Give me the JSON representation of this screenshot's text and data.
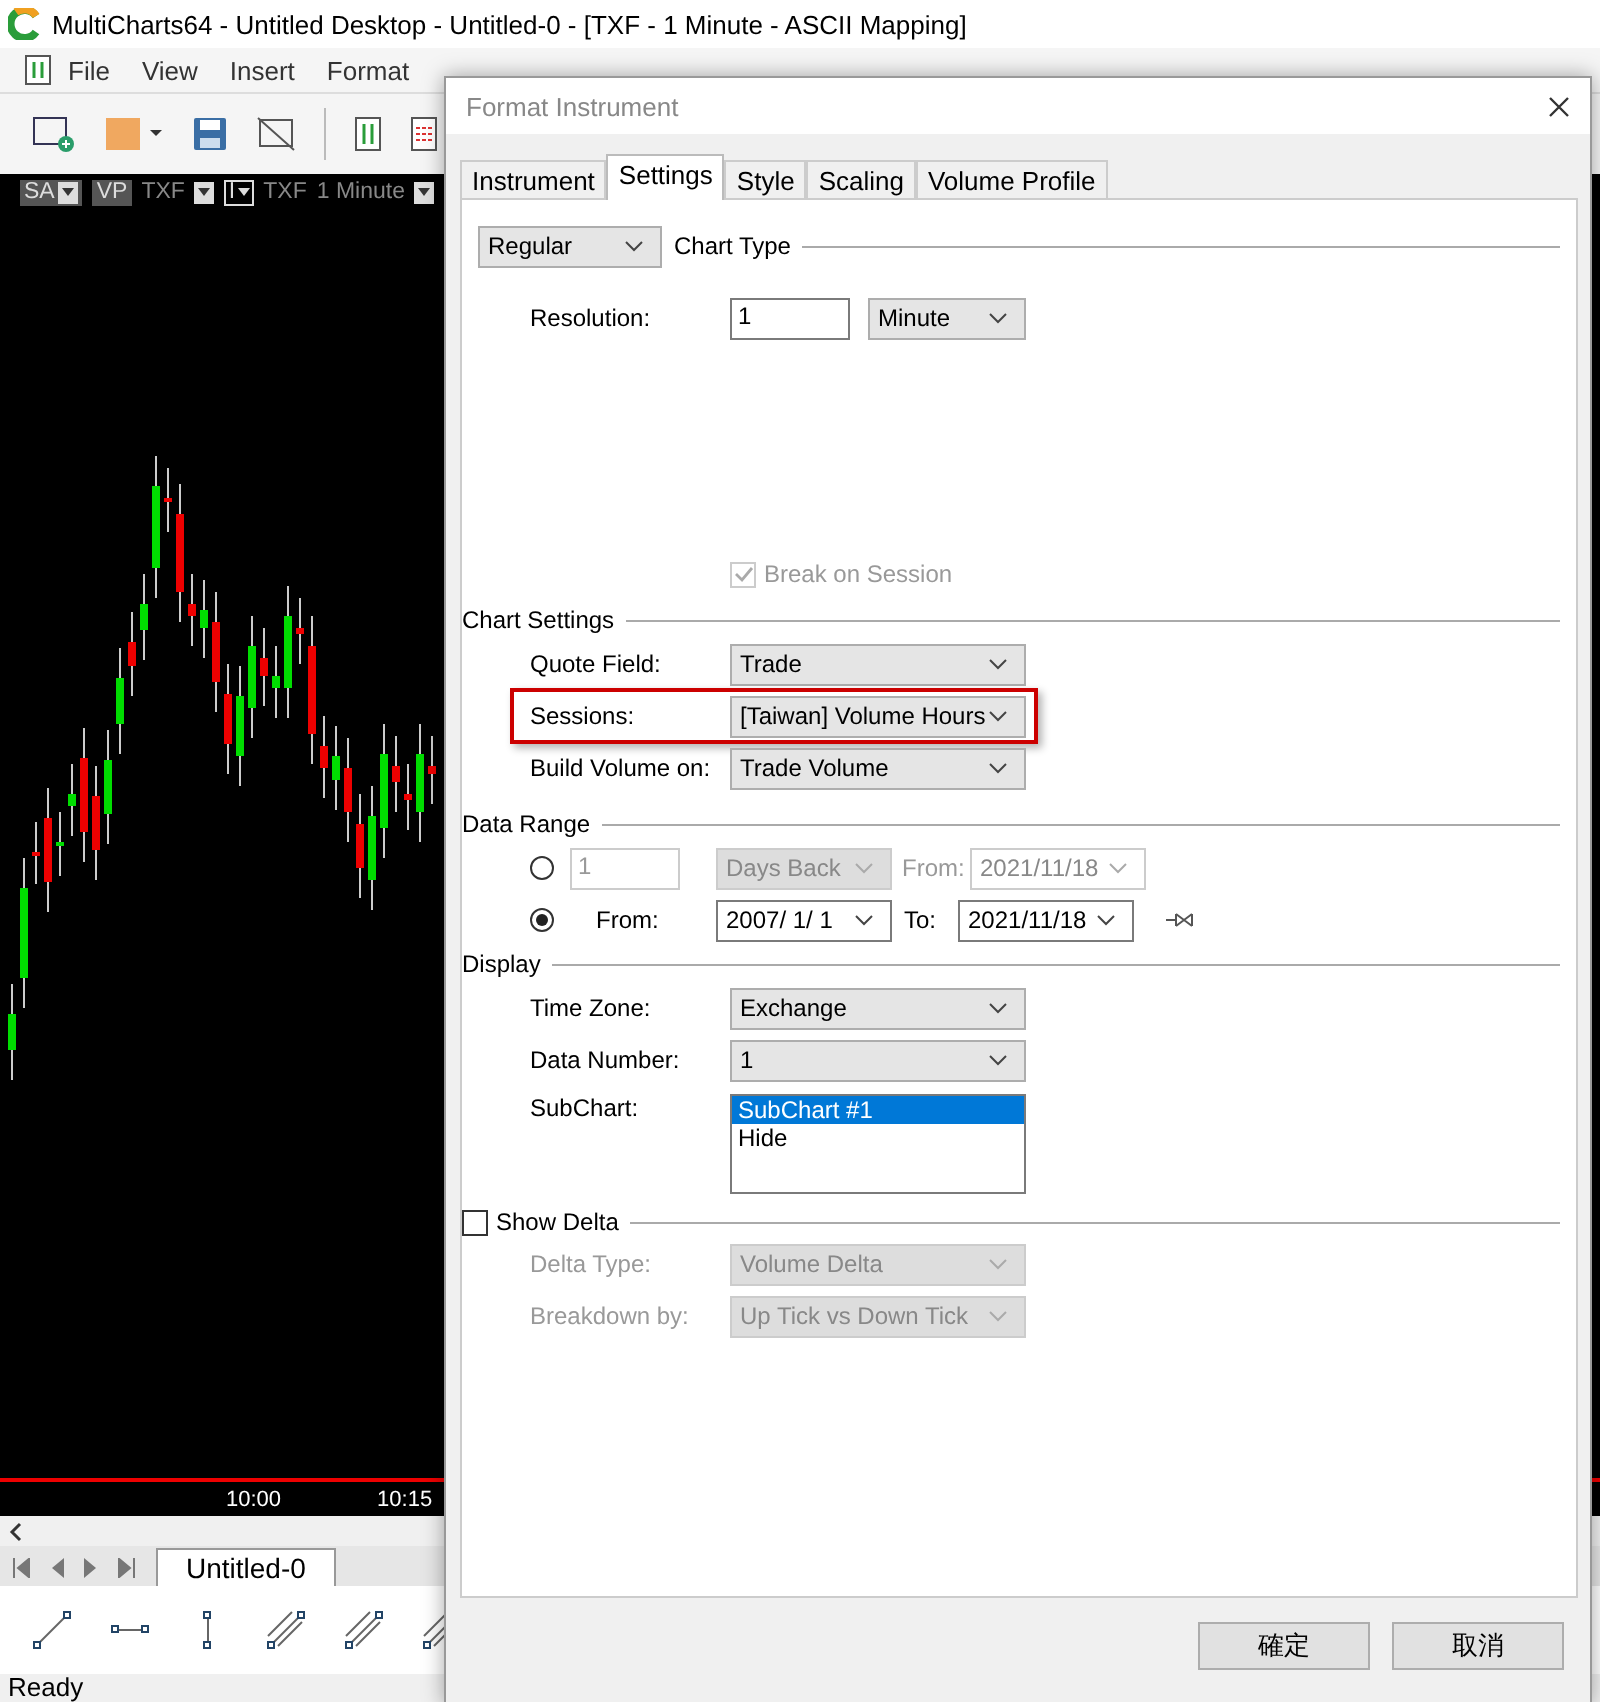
{
  "app": {
    "title": "MultiCharts64 - Untitled Desktop - Untitled-0 - [TXF - 1 Minute - ASCII Mapping]",
    "menu": [
      "File",
      "View",
      "Insert",
      "Format"
    ],
    "chart_bar": [
      {
        "kind": "badge",
        "label": "SA",
        "arrow": true
      },
      {
        "kind": "badge",
        "label": "VP",
        "arrow": false
      },
      {
        "kind": "text",
        "label": "TXF"
      },
      {
        "kind": "arrow"
      },
      {
        "kind": "boxed",
        "label": "I",
        "arrow": true
      },
      {
        "kind": "text",
        "label": "TXF"
      },
      {
        "kind": "text",
        "label": "1 Minute"
      },
      {
        "kind": "arrow"
      }
    ],
    "time_axis": [
      "10:00",
      "10:15"
    ],
    "sheet_tabs": [
      {
        "label": "Untitled-0",
        "selected": true
      }
    ],
    "status": "Ready"
  },
  "dialog": {
    "title": "Format Instrument",
    "tabs": [
      {
        "label": "Instrument",
        "selected": false
      },
      {
        "label": "Settings",
        "selected": true
      },
      {
        "label": "Style",
        "selected": false
      },
      {
        "label": "Scaling",
        "selected": false
      },
      {
        "label": "Volume Profile",
        "selected": false
      }
    ],
    "chart_type": {
      "value": "Regular",
      "label": "Chart Type"
    },
    "resolution": {
      "label": "Resolution:",
      "value": "1",
      "unit": "Minute"
    },
    "break_on_session": {
      "label": "Break on Session",
      "checked": true,
      "disabled": true
    },
    "chart_settings": {
      "title": "Chart Settings",
      "fields": [
        {
          "label": "Quote Field:",
          "value": "Trade",
          "highlighted": false
        },
        {
          "label": "Sessions:",
          "value": "[Taiwan] Volume Hours",
          "highlighted": true
        },
        {
          "label": "Build Volume on:",
          "value": "Trade Volume",
          "highlighted": false
        }
      ]
    },
    "data_range": {
      "title": "Data Range",
      "options": [
        {
          "kind": "days",
          "selected": false,
          "value": "1",
          "unit": "Days Back",
          "from_label": "From:",
          "from": "2021/11/18"
        },
        {
          "kind": "range",
          "selected": true,
          "from_label": "From:",
          "from": "2007/ 1/ 1",
          "to_label": "To:",
          "to": "2021/11/18"
        }
      ]
    },
    "display": {
      "title": "Display",
      "fields": [
        {
          "label": "Time Zone:",
          "value": "Exchange"
        },
        {
          "label": "Data Number:",
          "value": "1"
        }
      ],
      "subchart": {
        "label": "SubChart:",
        "items": [
          {
            "label": "SubChart #1",
            "selected": true
          },
          {
            "label": "Hide",
            "selected": false
          }
        ]
      }
    },
    "show_delta": {
      "label": "Show Delta",
      "checked": false,
      "fields": [
        {
          "label": "Delta Type:",
          "value": "Volume Delta"
        },
        {
          "label": "Breakdown by:",
          "value": "Up Tick vs Down Tick"
        }
      ]
    },
    "buttons": [
      "確定",
      "取消"
    ]
  }
}
